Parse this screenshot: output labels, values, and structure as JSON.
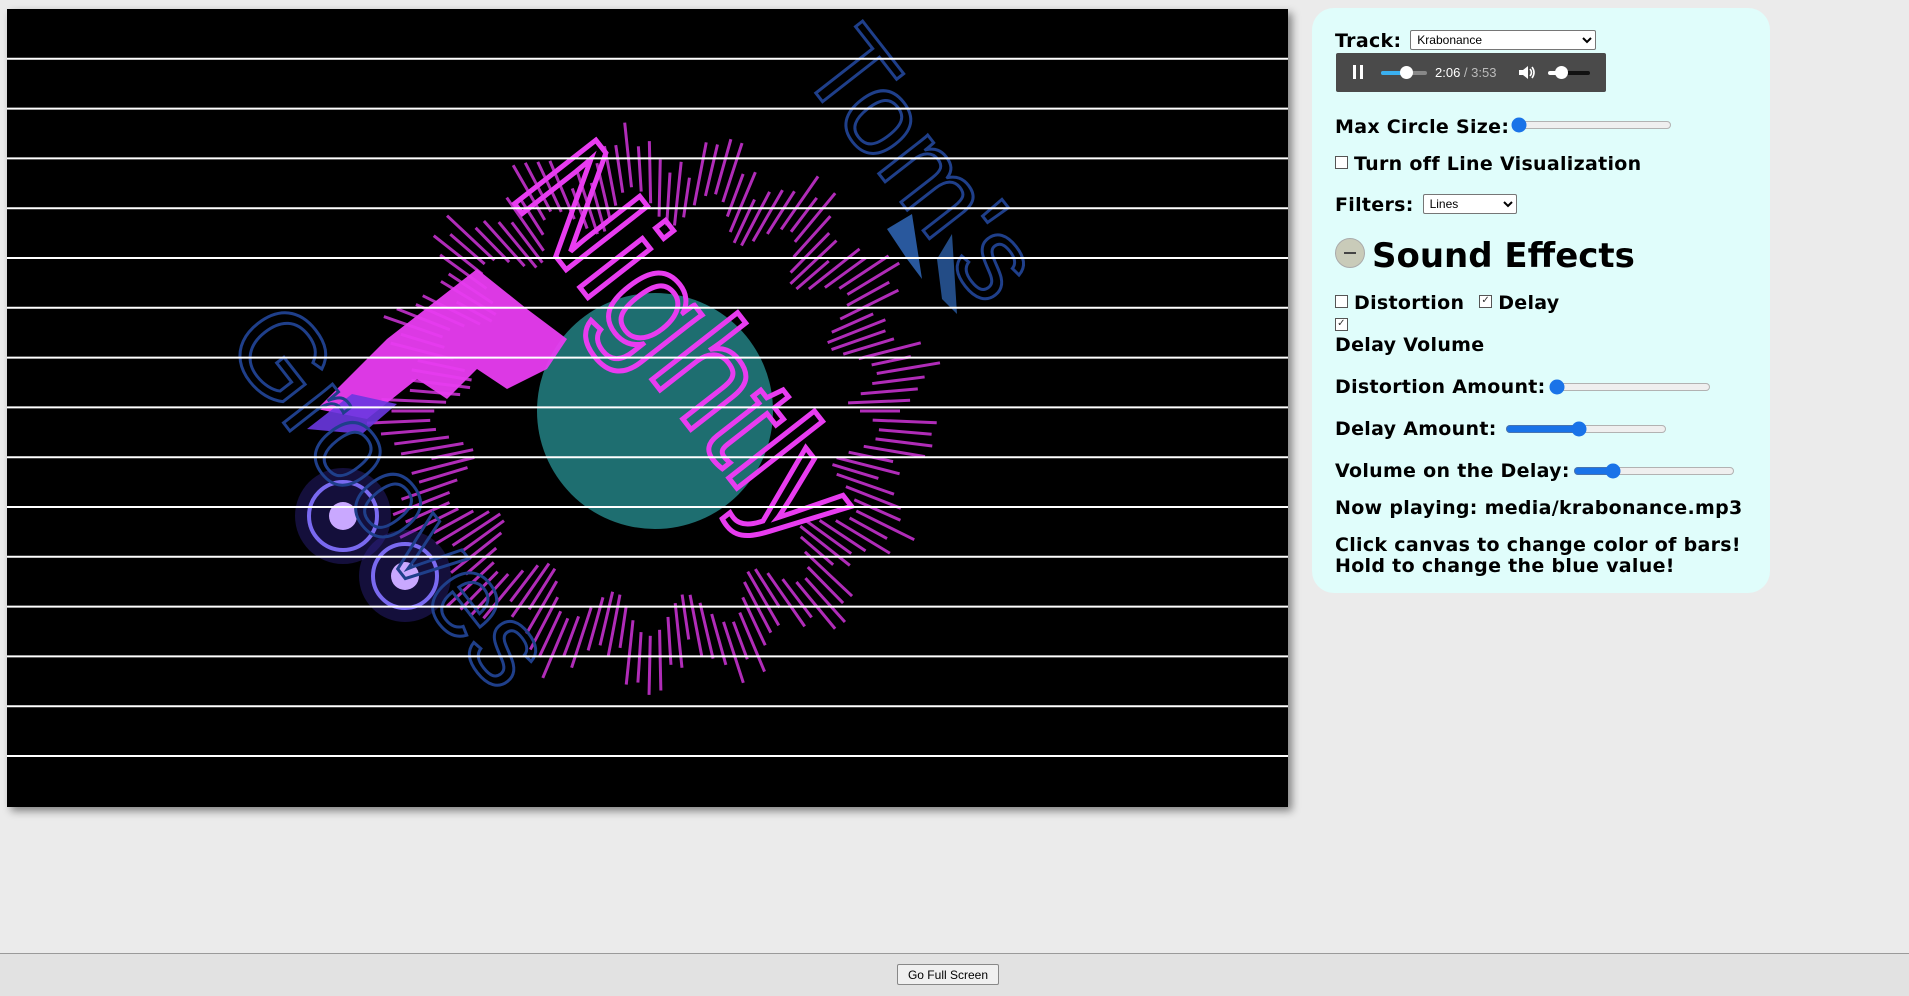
{
  "canvas": {
    "title_word_1": "Tom's",
    "title_word_2": "Nightly",
    "title_word_3": "Grooves"
  },
  "panel": {
    "track_label": "Track:",
    "track_selected": "Krabonance",
    "audio": {
      "current_time": "2:06",
      "separator": " / ",
      "duration": "3:53",
      "progress": 0.54,
      "volume": 0.3
    },
    "max_circle_label": "Max Circle Size:",
    "max_circle_value": 0.0,
    "line_vis_label": "Turn off Line Visualization",
    "line_vis_checked": false,
    "filters_label": "Filters:",
    "filters_selected": "Lines",
    "sound_effects_title": "Sound Effects",
    "distortion_label": "Distortion",
    "distortion_checked": false,
    "delay_label": "Delay",
    "delay_checked": true,
    "delay_volume_checked": true,
    "delay_volume_label": "Delay Volume",
    "distortion_amount_label": "Distortion Amount:",
    "distortion_amount_value": 0.0,
    "delay_amount_label": "Delay Amount:",
    "delay_amount_value": 0.45,
    "delay_volume_amount_label": "Volume on the Delay:",
    "delay_volume_amount_value": 0.22,
    "now_playing": "Now playing: media/krabonance.mp3",
    "hint_line_1": "Click canvas to change color of bars!",
    "hint_line_2": "Hold to change the blue value!"
  },
  "footer": {
    "fullscreen_label": "Go Full Screen"
  },
  "colors": {
    "magenta": "#e83cf0",
    "teal_circle": "#1e6e70",
    "blue_text": "#1f3f8a",
    "panel_bg": "#e0fdfb"
  }
}
